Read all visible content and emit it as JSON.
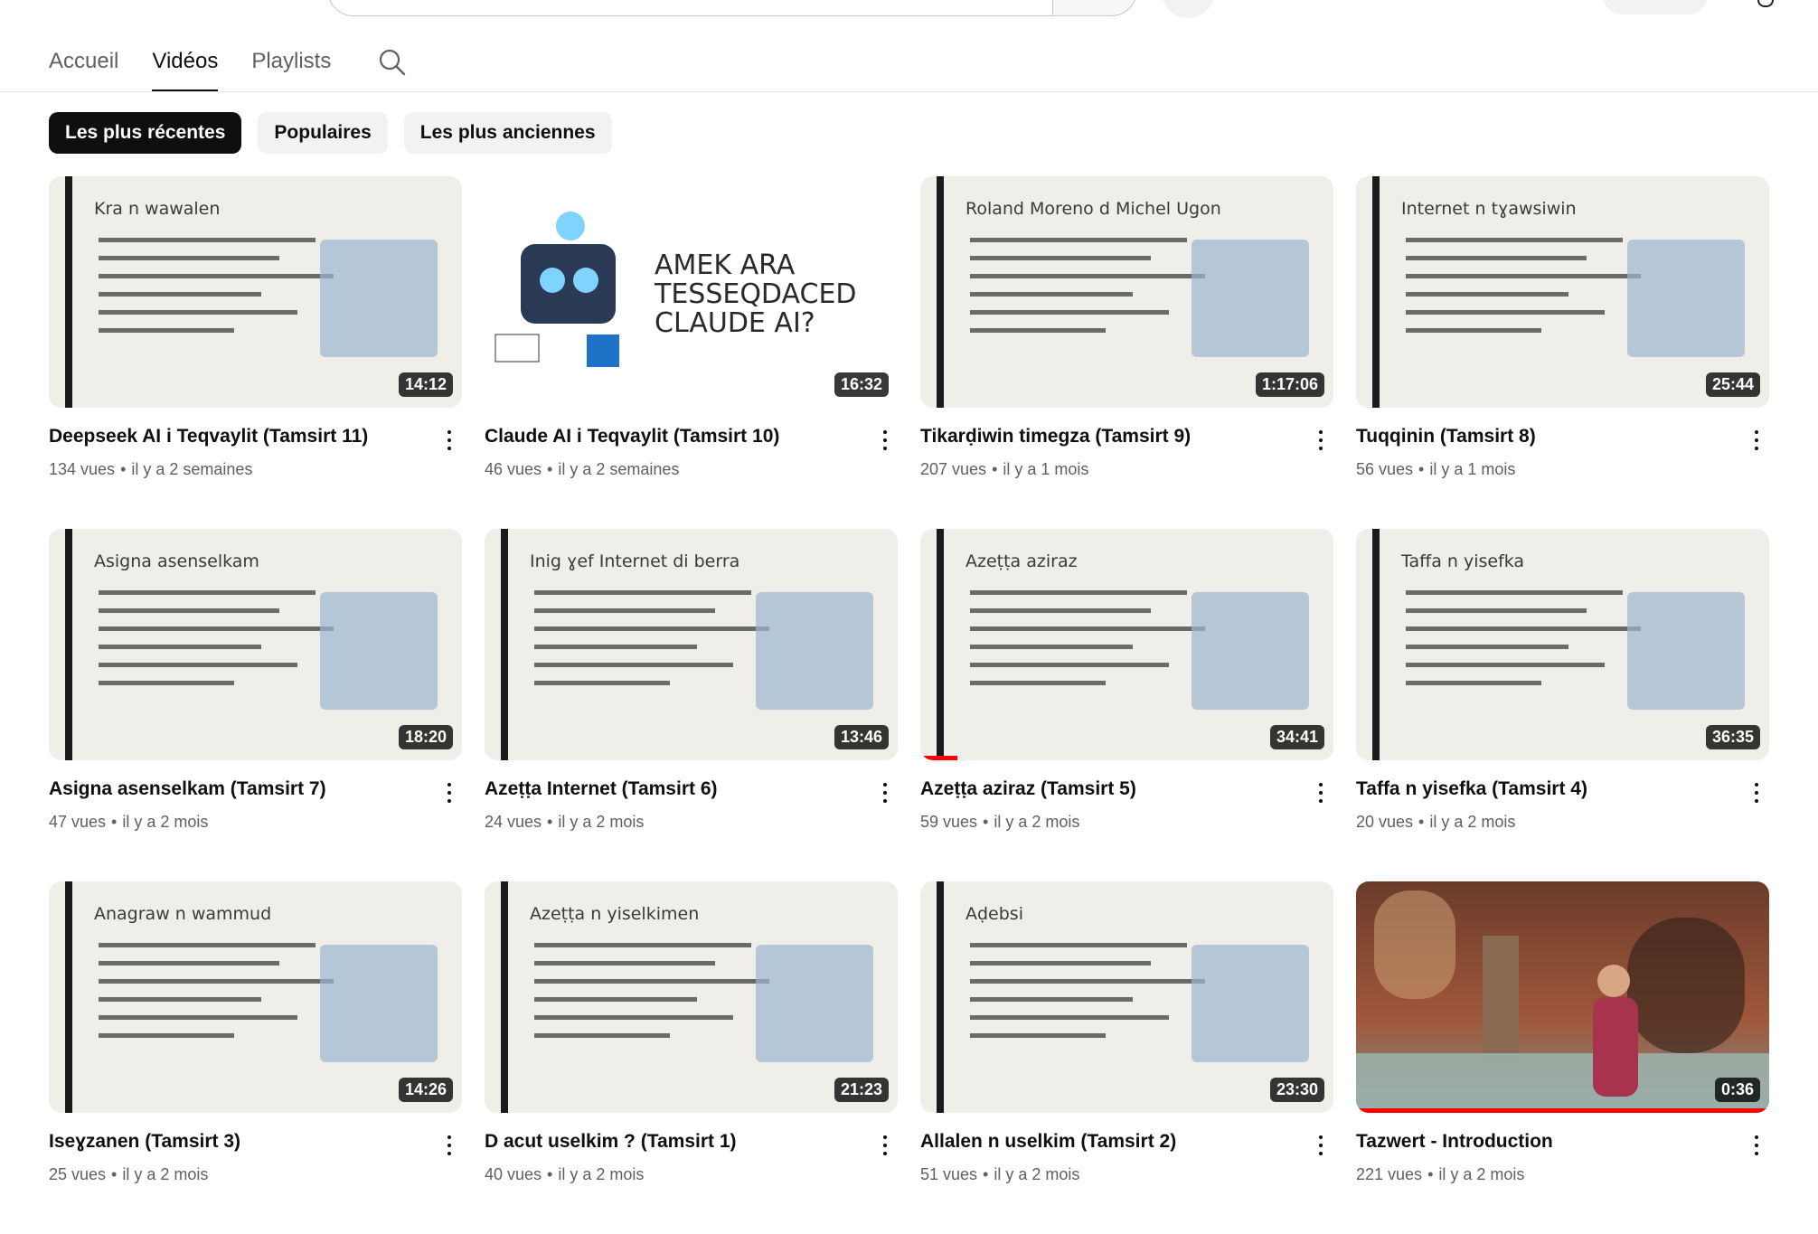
{
  "tabs": [
    {
      "label": "Accueil",
      "active": false
    },
    {
      "label": "Vidéos",
      "active": true
    },
    {
      "label": "Playlists",
      "active": false
    }
  ],
  "chips": [
    {
      "label": "Les plus récentes",
      "selected": true
    },
    {
      "label": "Populaires",
      "selected": false
    },
    {
      "label": "Les plus anciennes",
      "selected": false
    }
  ],
  "videos": [
    {
      "title": "Deepseek AI i Teqvaylit (Tamsirt 11)",
      "views": "134 vues",
      "age": "il y a 2 semaines",
      "duration": "14:12",
      "thumb_title": "Kra n wawalen",
      "progress": 0
    },
    {
      "title": "Claude AI i Teqvaylit (Tamsirt 10)",
      "views": "46 vues",
      "age": "il y a 2 semaines",
      "duration": "16:32",
      "thumb_title": "AMEK ARA TESSEQDACED CLAUDE AI?",
      "progress": 0
    },
    {
      "title": "Tikarḍiwin timegza (Tamsirt 9)",
      "views": "207 vues",
      "age": "il y a 1 mois",
      "duration": "1:17:06",
      "thumb_title": "Roland Moreno d Michel Ugon",
      "progress": 0
    },
    {
      "title": "Tuqqinin (Tamsirt 8)",
      "views": "56 vues",
      "age": "il y a 1 mois",
      "duration": "25:44",
      "thumb_title": "Internet n tɣawsiwin",
      "progress": 0
    },
    {
      "title": "Asigna asenselkam (Tamsirt 7)",
      "views": "47 vues",
      "age": "il y a 2 mois",
      "duration": "18:20",
      "thumb_title": "Asigna asenselkam",
      "progress": 0
    },
    {
      "title": "Azeṭṭa Internet (Tamsirt 6)",
      "views": "24 vues",
      "age": "il y a 2 mois",
      "duration": "13:46",
      "thumb_title": "Inig ɣef Internet di berra",
      "progress": 0
    },
    {
      "title": "Azeṭṭa aziraz (Tamsirt 5)",
      "views": "59 vues",
      "age": "il y a 2 mois",
      "duration": "34:41",
      "thumb_title": "Azeṭṭa aziraz",
      "progress": 0.09
    },
    {
      "title": "Taffa n yisefka (Tamsirt 4)",
      "views": "20 vues",
      "age": "il y a 2 mois",
      "duration": "36:35",
      "thumb_title": "Taffa n yisefka",
      "progress": 0
    },
    {
      "title": "Iseɣzanen (Tamsirt 3)",
      "views": "25 vues",
      "age": "il y a 2 mois",
      "duration": "14:26",
      "thumb_title": "Anagraw n wammud",
      "progress": 0
    },
    {
      "title": "D acut uselkim ? (Tamsirt 1)",
      "views": "40 vues",
      "age": "il y a 2 mois",
      "duration": "21:23",
      "thumb_title": "Azeṭṭa n yiselkimen",
      "progress": 0
    },
    {
      "title": "Allalen n uselkim (Tamsirt 2)",
      "views": "51 vues",
      "age": "il y a 2 mois",
      "duration": "23:30",
      "thumb_title": "Aḍebsi",
      "progress": 0
    },
    {
      "title": "Tazwert - Introduction",
      "views": "221 vues",
      "age": "il y a 2 mois",
      "duration": "0:36",
      "thumb_title": "",
      "progress": 1.0
    }
  ]
}
